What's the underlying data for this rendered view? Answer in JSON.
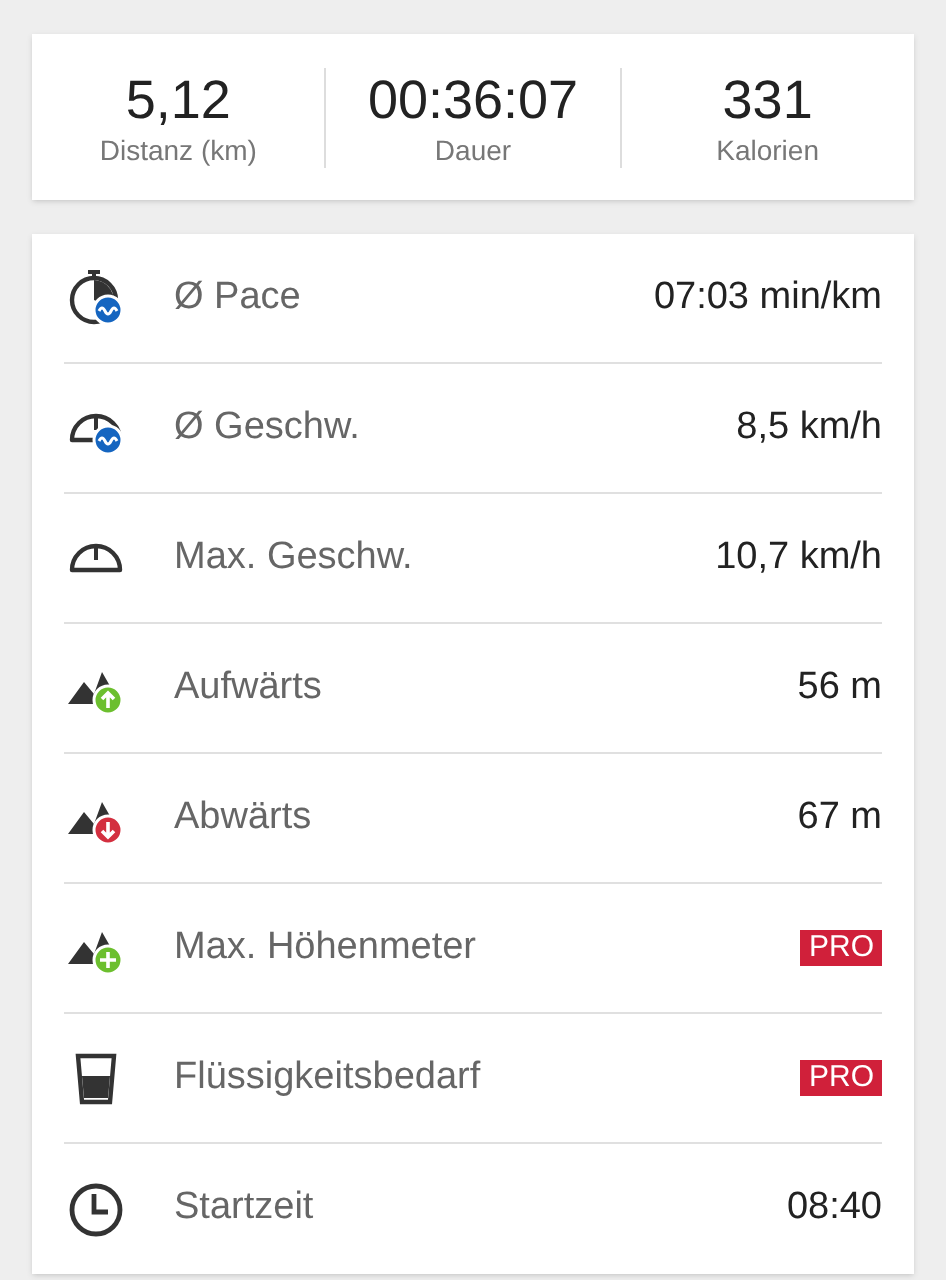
{
  "summary": [
    {
      "value": "5,12",
      "label": "Distanz (km)"
    },
    {
      "value": "00:36:07",
      "label": "Dauer"
    },
    {
      "value": "331",
      "label": "Kalorien"
    }
  ],
  "stats": [
    {
      "label": "Ø Pace",
      "kind": "value",
      "value": "07:03 min/km"
    },
    {
      "label": "Ø Geschw.",
      "kind": "value",
      "value": "8,5 km/h"
    },
    {
      "label": "Max. Geschw.",
      "kind": "value",
      "value": "10,7 km/h"
    },
    {
      "label": "Aufwärts",
      "kind": "value",
      "value": "56 m"
    },
    {
      "label": "Abwärts",
      "kind": "value",
      "value": "67 m"
    },
    {
      "label": "Max. Höhenmeter",
      "kind": "pro",
      "value": "PRO"
    },
    {
      "label": "Flüssigkeitsbedarf",
      "kind": "pro",
      "value": "PRO"
    },
    {
      "label": "Startzeit",
      "kind": "value",
      "value": "08:40"
    }
  ]
}
